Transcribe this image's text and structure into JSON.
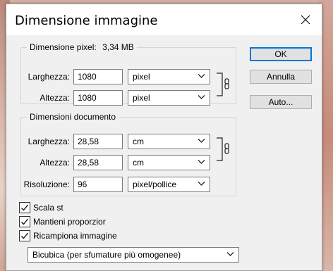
{
  "dialog": {
    "title": "Dimensione immagine"
  },
  "pixel_dimensions": {
    "legend": "Dimensione pixel:",
    "size": "3,34 MB",
    "width_label": "Larghezza:",
    "width_value": "1080",
    "width_unit": "pixel",
    "height_label": "Altezza:",
    "height_value": "1080",
    "height_unit": "pixel"
  },
  "document_size": {
    "legend": "Dimensioni documento",
    "width_label": "Larghezza:",
    "width_value": "28,58",
    "width_unit": "cm",
    "height_label": "Altezza:",
    "height_value": "28,58",
    "height_unit": "cm",
    "resolution_label": "Risoluzione:",
    "resolution_value": "96",
    "resolution_unit": "pixel/pollice"
  },
  "buttons": {
    "ok": "OK",
    "cancel": "Annulla",
    "auto": "Auto..."
  },
  "options": {
    "scale_styles": "Scala st",
    "constrain_proportions": "Mantieni proporzior",
    "resample": "Ricampiona immagine",
    "resample_method": "Bicubica (per sfumature più omogenee)"
  },
  "icons": {
    "close": "close-icon",
    "chevron": "chevron-down-icon",
    "link": "chain-link-icon",
    "check": "checkmark-icon"
  },
  "colors": {
    "default_button_border": "#0078d7",
    "title_bar": "#ffffff",
    "dialog_bg": "#f0f0f0"
  }
}
